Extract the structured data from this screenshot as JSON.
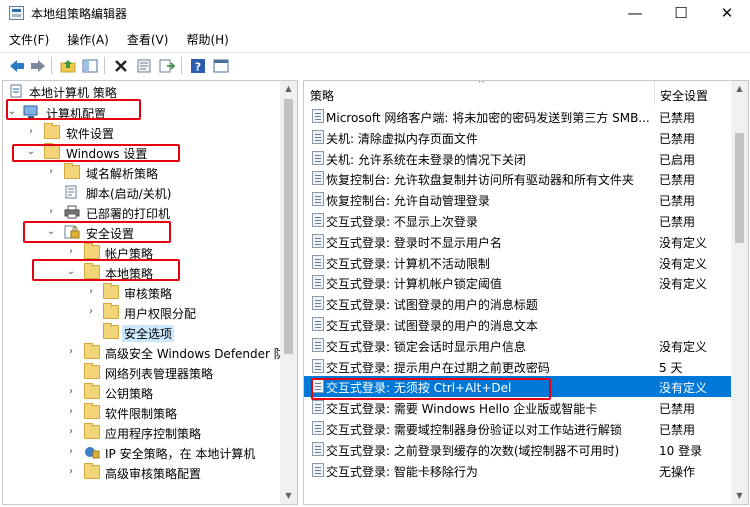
{
  "window": {
    "title": "本地组策略编辑器"
  },
  "menu": [
    "文件(F)",
    "操作(A)",
    "查看(V)",
    "帮助(H)"
  ],
  "toolbar": {
    "buttons": [
      "back-icon",
      "forward-icon",
      "up-folder-icon",
      "show-tree-icon",
      "delete-icon",
      "properties-icon",
      "export-icon",
      "help-icon",
      "view-icon"
    ]
  },
  "tree": {
    "root": "本地计算机 策略",
    "items": [
      {
        "label": "计算机配置",
        "expanded": true
      },
      {
        "label": "软件设置",
        "expanded": false
      },
      {
        "label": "Windows 设置",
        "expanded": true
      },
      {
        "label": "域名解析策略",
        "expanded": false
      },
      {
        "label": "脚本(启动/关机)",
        "expanded": false
      },
      {
        "label": "已部署的打印机",
        "expanded": false
      },
      {
        "label": "安全设置",
        "expanded": true
      },
      {
        "label": "帐户策略",
        "expanded": false
      },
      {
        "label": "本地策略",
        "expanded": true
      },
      {
        "label": "审核策略",
        "expanded": false
      },
      {
        "label": "用户权限分配",
        "expanded": false
      },
      {
        "label": "安全选项",
        "selected": true
      },
      {
        "label": "高级安全 Windows Defender 防",
        "expanded": false
      },
      {
        "label": "网络列表管理器策略",
        "expanded": false
      },
      {
        "label": "公钥策略",
        "expanded": false
      },
      {
        "label": "软件限制策略",
        "expanded": false
      },
      {
        "label": "应用程序控制策略",
        "expanded": false
      },
      {
        "label": "IP 安全策略，在 本地计算机",
        "expanded": false
      },
      {
        "label": "高级审核策略配置",
        "expanded": false
      }
    ]
  },
  "list": {
    "col_policy": "策略",
    "col_setting": "安全设置",
    "rows": [
      {
        "name": "Microsoft 网络客户端: 将未加密的密码发送到第三方 SMB...",
        "setting": "已禁用"
      },
      {
        "name": "关机: 清除虚拟内存页面文件",
        "setting": "已禁用"
      },
      {
        "name": "关机: 允许系统在未登录的情况下关闭",
        "setting": "已启用"
      },
      {
        "name": "恢复控制台: 允许软盘复制并访问所有驱动器和所有文件夹",
        "setting": "已禁用"
      },
      {
        "name": "恢复控制台: 允许自动管理登录",
        "setting": "已禁用"
      },
      {
        "name": "交互式登录: 不显示上次登录",
        "setting": "已禁用"
      },
      {
        "name": "交互式登录: 登录时不显示用户名",
        "setting": "没有定义"
      },
      {
        "name": "交互式登录: 计算机不活动限制",
        "setting": "没有定义"
      },
      {
        "name": "交互式登录: 计算机帐户锁定阈值",
        "setting": "没有定义"
      },
      {
        "name": "交互式登录: 试图登录的用户的消息标题",
        "setting": ""
      },
      {
        "name": "交互式登录: 试图登录的用户的消息文本",
        "setting": ""
      },
      {
        "name": "交互式登录: 锁定会话时显示用户信息",
        "setting": "没有定义"
      },
      {
        "name": "交互式登录: 提示用户在过期之前更改密码",
        "setting": "5 天"
      },
      {
        "name": "交互式登录: 无须按 Ctrl+Alt+Del",
        "setting": "没有定义",
        "selected": true
      },
      {
        "name": "交互式登录: 需要 Windows Hello 企业版或智能卡",
        "setting": "已禁用"
      },
      {
        "name": "交互式登录: 需要域控制器身份验证以对工作站进行解锁",
        "setting": "已禁用"
      },
      {
        "name": "交互式登录: 之前登录到缓存的次数(域控制器不可用时)",
        "setting": "10 登录"
      },
      {
        "name": "交互式登录: 智能卡移除行为",
        "setting": "无操作"
      }
    ]
  },
  "colors": {
    "selection": "#0078d7",
    "highlight_box": "#e60012"
  }
}
